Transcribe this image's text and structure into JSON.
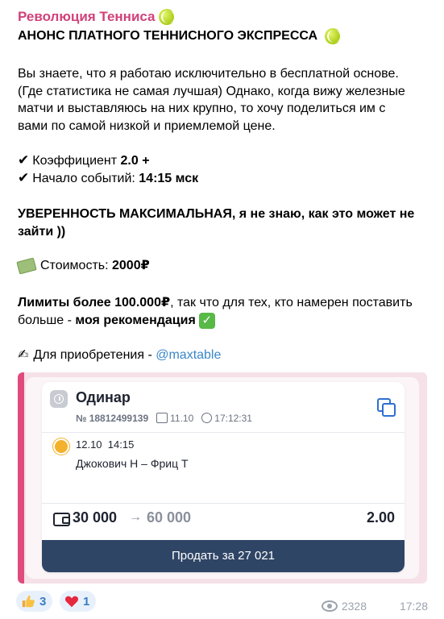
{
  "post": {
    "channel_name": "Революция Тенниса",
    "title": "АНОНС ПЛАТНОГО ТЕННИСНОГО ЭКСПРЕССА",
    "intro_lines": [
      "Вы знаете, что я работаю исключительно в бесплатной основе.",
      "(Где статистика не самая лучшая) Однако, когда вижу железные",
      "матчи и выставляюсь на них крупно, то хочу поделиться им с",
      "вами по самой низкой и приемлемой цене."
    ],
    "coef_label": "Коэффициент ",
    "coef_value": "2.0 +",
    "start_label": "Начало событий: ",
    "start_value": "14:15 мск",
    "confidence_line1": "УВЕРЕННОСТЬ МАКСИМАЛЬНАЯ, я не знаю, как это может не",
    "confidence_line2": "зайти ))",
    "price_label": "Стоимость: ",
    "price_value": "2000₽",
    "limits_bold": "Лимиты более 100.000₽",
    "limits_rest": ", так что для тех, кто намерен поставить",
    "limits_line2_plain": "больше - ",
    "limits_line2_bold": "моя рекомендация",
    "purchase_label": "Для приобретения - ",
    "purchase_link": "@maxtable"
  },
  "bet_card": {
    "title": "Одинар",
    "number": "№ 18812499139",
    "date": "11.10",
    "time": "17:12:31",
    "event_date": "12.10",
    "event_time": "14:15",
    "match": "Джокович Н – Фриц Т",
    "stake": "30 000",
    "arrow": "→",
    "payout": "60 000",
    "odds": "2.00",
    "sell_button": "Продать за 27 021"
  },
  "footer": {
    "reaction_thumbs_count": "3",
    "reaction_heart_count": "1",
    "views": "2328",
    "time": "17:28"
  },
  "colors": {
    "channel_name": "#d1427a",
    "link": "#3a86c8",
    "sell_button_bg": "#2f4566",
    "media_strip": "#e04b7e"
  },
  "icons": [
    "tennis-ball-icon",
    "checkmark-icon",
    "money-icon",
    "check-box-icon",
    "writing-hand-icon",
    "clock-icon",
    "copy-icon",
    "calendar-icon",
    "bet-icon",
    "wallet-icon",
    "thumbs-up-icon",
    "heart-icon",
    "eye-icon"
  ]
}
